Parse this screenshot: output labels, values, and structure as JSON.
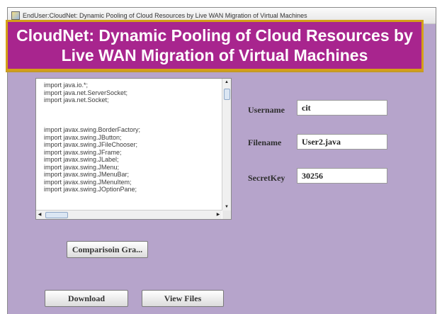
{
  "window": {
    "title": "EndUser:CloudNet: Dynamic Pooling of Cloud Resources by Live WAN Migration of Virtual Machines"
  },
  "banner": {
    "line1": "CloudNet: Dynamic Pooling of Cloud Resources by",
    "line2": "Live WAN Migration of Virtual Machines"
  },
  "code": {
    "lines": [
      "import java.io.*;",
      "import java.net.ServerSocket;",
      "import java.net.Socket;",
      "",
      "",
      "",
      "import javax.swing.BorderFactory;",
      "import javax.swing.JButton;",
      "import javax.swing.JFileChooser;",
      "import javax.swing.JFrame;",
      "import javax.swing.JLabel;",
      "import javax.swing.JMenu;",
      "import javax.swing.JMenuBar;",
      "import javax.swing.JMenuItem;",
      "import javax.swing.JOptionPane;"
    ]
  },
  "form": {
    "username_label": "Username",
    "username_value": "cit",
    "filename_label": "Filename",
    "filename_value": "User2.java",
    "secretkey_label": "SecretKey",
    "secretkey_value": "30256"
  },
  "buttons": {
    "comparison": "Comparisoin Gra...",
    "download": "Download",
    "view_files": "View Files"
  },
  "colors": {
    "panel_background": "#b6a4cb",
    "banner_background": "#a8258e",
    "banner_border": "#d4a017"
  }
}
